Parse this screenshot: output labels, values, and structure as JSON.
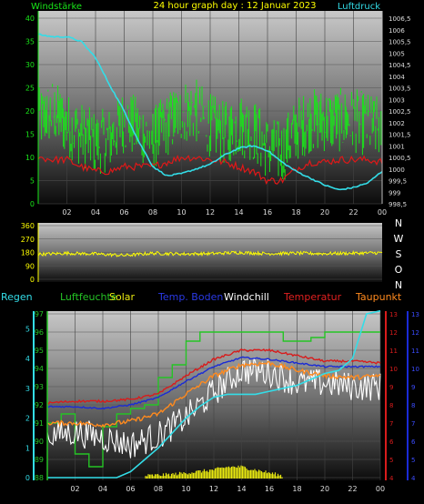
{
  "title": "24 hour graph day : 12 Januar 2023",
  "colors": {
    "wind": "#19e619",
    "wind_dark": "#0a7a0a",
    "gust": "#e01818",
    "pressure": "#33dde8",
    "direction": "#ffff00",
    "humidity": "#25c425",
    "solar": "#e8e810",
    "soil_temp": "#1a2bd6",
    "windchill": "#ffffff",
    "temperature": "#d81c1c",
    "dewpoint": "#ff8a1e",
    "rain": "#33dde8"
  },
  "x_ticks": [
    "02",
    "04",
    "06",
    "08",
    "10",
    "12",
    "14",
    "16",
    "18",
    "20",
    "22",
    "00"
  ],
  "chart_data": [
    {
      "type": "line",
      "name": "wind-pressure",
      "labels": {
        "left": "Windstärke",
        "right": "Luftdruck"
      },
      "left_axis": {
        "ticks": [
          0,
          5,
          10,
          15,
          20,
          25,
          30,
          35,
          40
        ],
        "ylim": [
          0,
          40
        ]
      },
      "right_axis": {
        "ticks": [
          "998,5",
          "999",
          "999,5",
          "1000",
          "1000,5",
          "1001",
          "1001,5",
          "1002",
          "1002,5",
          "1003",
          "1003,5",
          "1004",
          "1004,5",
          "1005",
          "1005,5",
          "1006",
          "1006,5"
        ],
        "ylim": [
          998.5,
          1006.5
        ]
      },
      "series": [
        {
          "name": "Windstärke",
          "axis": "left",
          "x": [
            0,
            1,
            2,
            3,
            4,
            5,
            6,
            7,
            8,
            9,
            10,
            11,
            12,
            13,
            14,
            15,
            16,
            17,
            18,
            19,
            20,
            21,
            22,
            23,
            24
          ],
          "y": [
            18,
            20,
            17,
            15,
            13,
            14,
            18,
            16,
            14,
            17,
            20,
            20,
            17,
            15,
            17,
            16,
            12,
            11,
            16,
            18,
            18,
            18,
            18,
            17,
            16
          ]
        },
        {
          "name": "Böen",
          "axis": "left",
          "x": [
            0,
            1,
            2,
            3,
            4,
            5,
            6,
            7,
            8,
            9,
            10,
            11,
            12,
            13,
            14,
            15,
            16,
            17,
            18,
            19,
            20,
            21,
            22,
            23,
            24
          ],
          "y": [
            10,
            9.5,
            9.5,
            8,
            7,
            7,
            8,
            8,
            8,
            9,
            10,
            10,
            9.5,
            9,
            8,
            7,
            5,
            5,
            7.5,
            9,
            9,
            9.5,
            9.5,
            9.5,
            9
          ]
        },
        {
          "name": "Luftdruck",
          "axis": "right",
          "x": [
            0,
            1,
            2,
            3,
            4,
            5,
            6,
            7,
            8,
            9,
            10,
            11,
            12,
            13,
            14,
            15,
            16,
            17,
            18,
            19,
            20,
            21,
            22,
            23,
            24
          ],
          "y": [
            1005.8,
            1005.7,
            1005.7,
            1005.5,
            1004.8,
            1003.6,
            1002.5,
            1001.2,
            1000.1,
            999.7,
            999.8,
            1000,
            1000.2,
            1000.6,
            1000.9,
            1001,
            1000.8,
            1000.3,
            999.9,
            999.6,
            999.3,
            999.1,
            999.2,
            999.4,
            999.9
          ]
        }
      ]
    },
    {
      "type": "line",
      "name": "wind-direction",
      "left_axis": {
        "ticks": [
          0,
          90,
          180,
          270,
          360
        ],
        "ylim": [
          0,
          360
        ]
      },
      "right_labels": [
        "N",
        "W",
        "S",
        "O",
        "N"
      ],
      "series": [
        {
          "name": "Windrichtung",
          "x": [
            0,
            2,
            4,
            6,
            8,
            10,
            12,
            14,
            16,
            18,
            20,
            22,
            24
          ],
          "y": [
            168,
            175,
            170,
            160,
            175,
            170,
            172,
            180,
            172,
            175,
            172,
            175,
            178
          ]
        }
      ]
    },
    {
      "type": "line",
      "name": "humidity-temperature",
      "labels": [
        "Regen",
        "Luftfeuchte",
        "Solar",
        "Temp. Boden",
        "Windchill",
        "Temperatur",
        "Taupunkt"
      ],
      "left_axis": {
        "ticks": [
          0,
          1,
          2,
          3,
          4,
          5
        ],
        "ylim": [
          0,
          5.5
        ]
      },
      "humidity_axis": {
        "ticks": [
          88,
          89,
          90,
          91,
          92,
          93,
          94,
          95,
          96,
          97
        ],
        "ylim": [
          88,
          97
        ]
      },
      "right_axis_1": {
        "ticks": [
          4,
          5,
          6,
          7,
          8,
          9,
          10,
          11,
          12,
          13
        ],
        "ylim": [
          4,
          13
        ]
      },
      "right_axis_2": {
        "ticks": [
          4,
          5,
          6,
          7,
          8,
          9,
          10,
          11,
          12,
          13
        ],
        "ylim": [
          4,
          13
        ]
      },
      "series": [
        {
          "name": "Luftfeuchte",
          "x": [
            0,
            1,
            1,
            2,
            2,
            3,
            3,
            4,
            4,
            5,
            5,
            6,
            6,
            7,
            7,
            8,
            8,
            9,
            9,
            10,
            10,
            11,
            11,
            12,
            12,
            13,
            13,
            14,
            14,
            15,
            15,
            16,
            16,
            17,
            17,
            18,
            18,
            19,
            19,
            20,
            20,
            21,
            21,
            22,
            22,
            23,
            23,
            24
          ],
          "y": [
            91,
            91,
            91.5,
            91.5,
            89.3,
            89.3,
            88.6,
            88.6,
            90.8,
            90.8,
            91.5,
            91.5,
            91.8,
            91.8,
            92,
            92,
            93.5,
            93.5,
            94.2,
            94.2,
            95.5,
            95.5,
            96,
            96,
            96,
            96,
            96,
            96,
            96,
            96,
            96,
            96,
            96,
            96,
            95.5,
            95.5,
            95.5,
            95.5,
            95.7,
            95.7,
            96,
            96,
            96,
            96,
            96,
            96,
            96,
            96
          ]
        },
        {
          "name": "Temp. Boden",
          "x": [
            0,
            2,
            4,
            6,
            8,
            10,
            12,
            14,
            16,
            18,
            20,
            22,
            24
          ],
          "y": [
            7.9,
            7.9,
            7.8,
            8.0,
            8.4,
            9.3,
            10.1,
            10.6,
            10.5,
            10.3,
            10.1,
            10.1,
            10.1
          ]
        },
        {
          "name": "Temperatur",
          "x": [
            0,
            2,
            4,
            6,
            8,
            10,
            12,
            14,
            16,
            18,
            20,
            22,
            24
          ],
          "y": [
            8.1,
            8.2,
            8.2,
            8.3,
            8.6,
            9.6,
            10.5,
            11.0,
            11.0,
            10.7,
            10.4,
            10.4,
            10.3
          ]
        },
        {
          "name": "Taupunkt",
          "x": [
            0,
            2,
            4,
            6,
            8,
            10,
            12,
            14,
            16,
            18,
            20,
            22,
            24
          ],
          "y": [
            7.0,
            7.0,
            6.9,
            7.1,
            7.5,
            8.6,
            9.6,
            10.2,
            10.3,
            9.9,
            9.6,
            9.5,
            9.6
          ]
        },
        {
          "name": "Windchill",
          "x": [
            0,
            2,
            4,
            6,
            8,
            10,
            12,
            14,
            16,
            18,
            20,
            22,
            24
          ],
          "y": [
            6.3,
            6.5,
            6.2,
            5.8,
            6.3,
            7.3,
            8.7,
            9.9,
            9.8,
            9.2,
            9.2,
            9.0,
            9.0
          ]
        },
        {
          "name": "Regen",
          "x": [
            0,
            5,
            6,
            7,
            8,
            9,
            10,
            11,
            12,
            13,
            14,
            15,
            16,
            17,
            18,
            19,
            20,
            21,
            22,
            23,
            24
          ],
          "y": [
            0,
            0,
            0.2,
            0.6,
            1.0,
            1.5,
            2.0,
            2.4,
            2.7,
            2.8,
            2.8,
            2.8,
            2.9,
            3.0,
            3.1,
            3.3,
            3.5,
            3.6,
            4.0,
            5.5,
            5.6
          ]
        },
        {
          "name": "Solar",
          "x": [
            0,
            7,
            9,
            10,
            11,
            12,
            13,
            14,
            15,
            16,
            17,
            24
          ],
          "y": [
            0,
            0,
            0.05,
            0.1,
            0.15,
            0.2,
            0.3,
            0.3,
            0.2,
            0.1,
            0,
            0
          ]
        }
      ]
    }
  ]
}
